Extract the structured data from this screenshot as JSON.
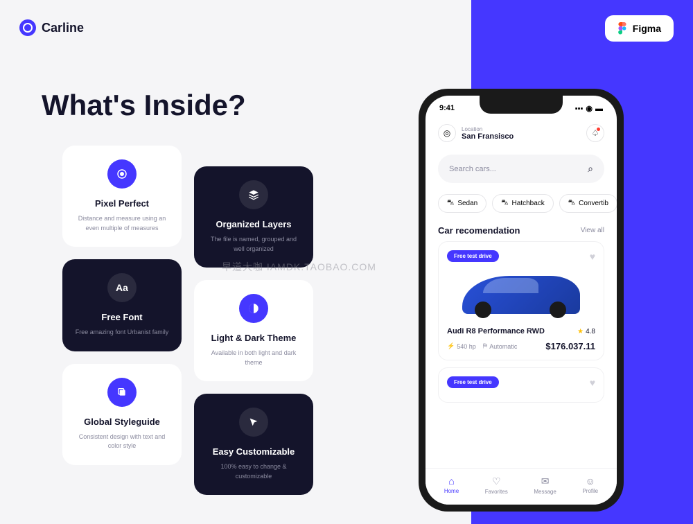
{
  "brand": {
    "name": "Carline"
  },
  "figma": {
    "label": "Figma"
  },
  "headline": "What's Inside?",
  "features": {
    "col_a": [
      {
        "title": "Pixel Perfect",
        "desc": "Distance and measure using an even multiple of measures",
        "theme": "light",
        "icon": "target-icon"
      },
      {
        "title": "Free Font",
        "desc": "Free amazing font Urbanist family",
        "theme": "dark",
        "icon": "font-icon",
        "glyph": "Aa"
      },
      {
        "title": "Global Styleguide",
        "desc": "Consistent design with text and color style",
        "theme": "light",
        "icon": "copy-icon"
      }
    ],
    "col_b": [
      {
        "title": "Organized Layers",
        "desc": "The file is named, grouped and well organized",
        "theme": "dark",
        "icon": "layers-icon"
      },
      {
        "title": "Light & Dark Theme",
        "desc": "Available in both light and dark theme",
        "theme": "light",
        "icon": "contrast-icon"
      },
      {
        "title": "Easy Customizable",
        "desc": "100% easy to change & customizable",
        "theme": "dark",
        "icon": "cursor-icon"
      }
    ]
  },
  "phone": {
    "status": {
      "time": "9:41"
    },
    "header": {
      "loc_label": "Location",
      "loc_value": "San Fransisco"
    },
    "search": {
      "placeholder": "Search cars..."
    },
    "chips": [
      {
        "label": "Sedan"
      },
      {
        "label": "Hatchback"
      },
      {
        "label": "Convertib"
      }
    ],
    "section": {
      "title": "Car recomendation",
      "link": "View all"
    },
    "car": {
      "badge": "Free test drive",
      "name": "Audi R8 Performance RWD",
      "rating": "4.8",
      "hp": "540 hp",
      "trans": "Automatic",
      "price": "$176.037.11"
    },
    "car2": {
      "badge": "Free test drive"
    },
    "nav": [
      {
        "label": "Home",
        "active": true
      },
      {
        "label": "Favorites"
      },
      {
        "label": "Message"
      },
      {
        "label": "Profile"
      }
    ]
  },
  "watermark": "早道大咖  IAMDK.TAOBAO.COM"
}
